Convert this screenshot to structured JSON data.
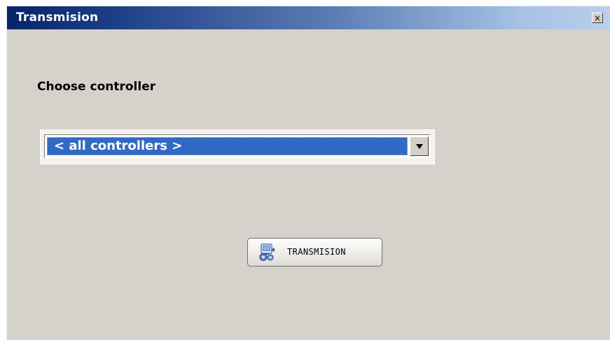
{
  "window": {
    "title": "Transmision",
    "close_glyph": "×"
  },
  "form": {
    "choose_label": "Choose controller",
    "controller_select": {
      "selected": "< all controllers >",
      "arrow_icon": "chevron-down-icon"
    }
  },
  "actions": {
    "transmit_label": "TRANSMISION",
    "transmit_icon": "transmission-icon"
  },
  "colors": {
    "titlebar_start": "#08246b",
    "titlebar_end": "#b9cfed",
    "selection": "#316ac5",
    "window_bg": "#d5d1cb"
  }
}
